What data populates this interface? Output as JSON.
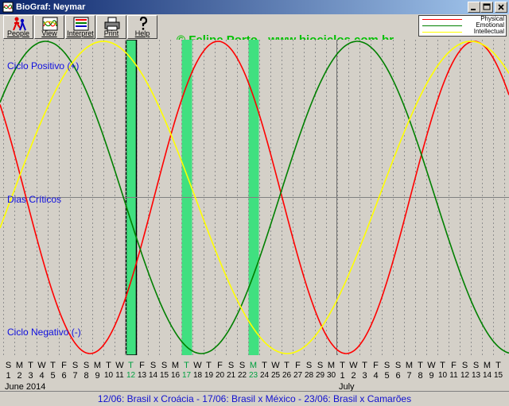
{
  "window": {
    "title": "BioGraf: Neymar"
  },
  "toolbar": {
    "buttons": [
      {
        "label": "People",
        "icon": "people-icon"
      },
      {
        "label": "View",
        "icon": "view-icon"
      },
      {
        "label": "Interpret",
        "icon": "interpret-icon"
      },
      {
        "label": "Print",
        "icon": "print-icon"
      },
      {
        "label": "Help",
        "icon": "help-icon"
      }
    ],
    "copyright": "© Felipe Porto - www.biociclos.com.br"
  },
  "legend": {
    "items": [
      {
        "label": "Physical",
        "color": "#ff0000"
      },
      {
        "label": "Emotional",
        "color": "#008000"
      },
      {
        "label": "Intellectual",
        "color": "#ffff00"
      }
    ]
  },
  "labels": {
    "positive": "Ciclo Positivo (+)",
    "critical": "Dias Críticos",
    "negative": "Ciclo Negativo (-)"
  },
  "colors": {
    "chart_bg": "#d4d0c8",
    "highlight": "#40e080",
    "grid": "#909090",
    "label_text": "#1010e0"
  },
  "chart_data": {
    "type": "line",
    "x_start": "2014-06-01",
    "x_end": "2014-07-15",
    "days": [
      {
        "date": 1,
        "letter": "S"
      },
      {
        "date": 2,
        "letter": "M"
      },
      {
        "date": 3,
        "letter": "T"
      },
      {
        "date": 4,
        "letter": "W"
      },
      {
        "date": 5,
        "letter": "T"
      },
      {
        "date": 6,
        "letter": "F"
      },
      {
        "date": 7,
        "letter": "S"
      },
      {
        "date": 8,
        "letter": "S"
      },
      {
        "date": 9,
        "letter": "M"
      },
      {
        "date": 10,
        "letter": "T"
      },
      {
        "date": 11,
        "letter": "W"
      },
      {
        "date": 12,
        "letter": "T"
      },
      {
        "date": 13,
        "letter": "F"
      },
      {
        "date": 14,
        "letter": "S"
      },
      {
        "date": 15,
        "letter": "S"
      },
      {
        "date": 16,
        "letter": "M"
      },
      {
        "date": 17,
        "letter": "T"
      },
      {
        "date": 18,
        "letter": "W"
      },
      {
        "date": 19,
        "letter": "T"
      },
      {
        "date": 20,
        "letter": "F"
      },
      {
        "date": 21,
        "letter": "S"
      },
      {
        "date": 22,
        "letter": "S"
      },
      {
        "date": 23,
        "letter": "M"
      },
      {
        "date": 24,
        "letter": "T"
      },
      {
        "date": 25,
        "letter": "W"
      },
      {
        "date": 26,
        "letter": "T"
      },
      {
        "date": 27,
        "letter": "F"
      },
      {
        "date": 28,
        "letter": "S"
      },
      {
        "date": 29,
        "letter": "S"
      },
      {
        "date": 30,
        "letter": "M"
      },
      {
        "date": 1,
        "letter": "T"
      },
      {
        "date": 2,
        "letter": "W"
      },
      {
        "date": 3,
        "letter": "T"
      },
      {
        "date": 4,
        "letter": "F"
      },
      {
        "date": 5,
        "letter": "S"
      },
      {
        "date": 6,
        "letter": "S"
      },
      {
        "date": 7,
        "letter": "M"
      },
      {
        "date": 8,
        "letter": "T"
      },
      {
        "date": 9,
        "letter": "W"
      },
      {
        "date": 10,
        "letter": "T"
      },
      {
        "date": 11,
        "letter": "F"
      },
      {
        "date": 12,
        "letter": "S"
      },
      {
        "date": 13,
        "letter": "S"
      },
      {
        "date": 14,
        "letter": "M"
      },
      {
        "date": 15,
        "letter": "T"
      }
    ],
    "months": [
      {
        "label": "June 2014",
        "day_index": 0
      },
      {
        "label": "July",
        "day_index": 30
      }
    ],
    "highlighted_day_indices": [
      11,
      16,
      22
    ],
    "selected_day_index": 11,
    "series": [
      {
        "name": "Physical",
        "color": "#ff0000",
        "period_days": 23,
        "peak_day_index": 18.8
      },
      {
        "name": "Emotional",
        "color": "#008000",
        "period_days": 28,
        "peak_day_index": 3.3
      },
      {
        "name": "Intellectual",
        "color": "#ffff00",
        "period_days": 33,
        "peak_day_index": 8.5
      }
    ],
    "ylim": [
      -1,
      1
    ]
  },
  "status": {
    "text": "12/06: Brasil x Croácia - 17/06: Brasil x México - 23/06: Brasil x Camarões"
  }
}
